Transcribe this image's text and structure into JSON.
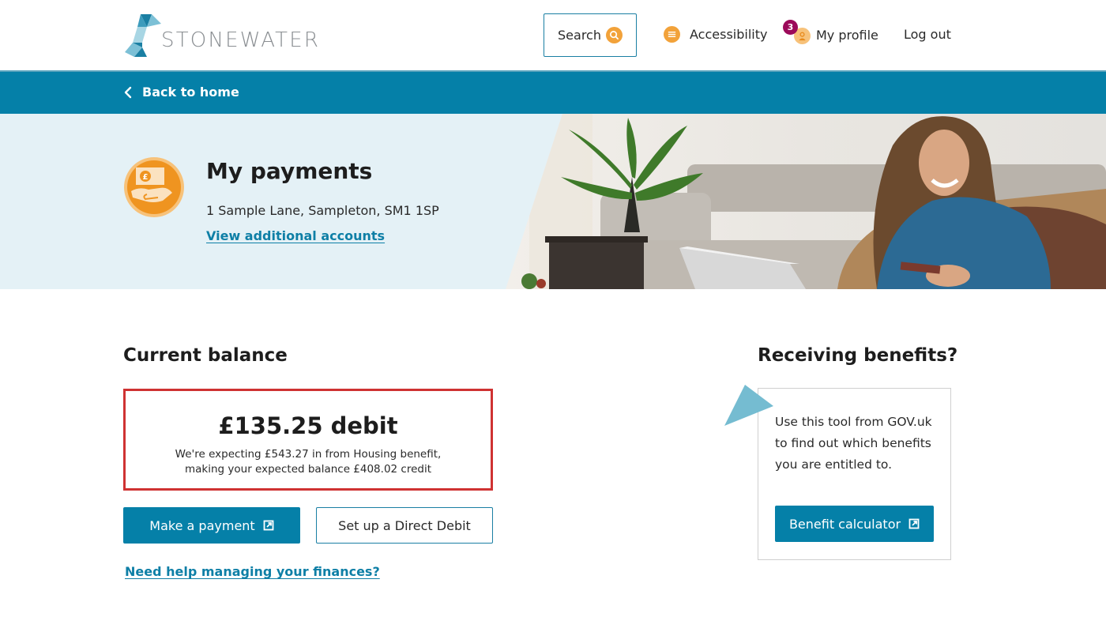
{
  "brand": {
    "name": "STONEWATER",
    "accent": "#0580a8",
    "highlight": "#f2a23a",
    "alert": "#cf3232"
  },
  "header": {
    "search_label": "Search",
    "accessibility_label": "Accessibility",
    "profile_label": "My profile",
    "profile_badge_count": "3",
    "logout_label": "Log out"
  },
  "backbar": {
    "back_label": "Back to home"
  },
  "hero": {
    "title": "My payments",
    "address": "1 Sample Lane, Sampleton, SM1 1SP",
    "accounts_link": "View additional accounts"
  },
  "balance": {
    "heading": "Current balance",
    "amount": "£135.25 debit",
    "note_line1": "We're expecting £543.27 in from Housing benefit,",
    "note_line2": "making your expected balance £408.02 credit",
    "make_payment_label": "Make a payment",
    "direct_debit_label": "Set up a Direct Debit",
    "help_link": "Need help managing your finances?"
  },
  "benefits": {
    "heading": "Receiving benefits?",
    "description": "Use this tool from GOV.uk to find out which benefits you are entitled to.",
    "calculator_label": "Benefit calculator"
  },
  "icons": {
    "search": "search-icon",
    "accessibility": "accessibility-icon",
    "profile": "user-icon",
    "back": "chevron-left-icon",
    "external": "external-link-icon",
    "payments": "hand-money-icon"
  }
}
